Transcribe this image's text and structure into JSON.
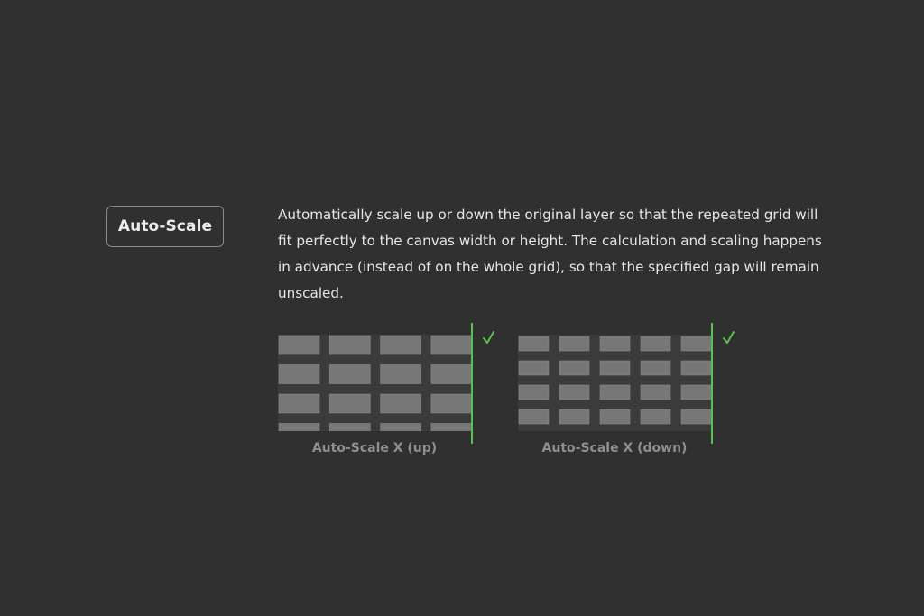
{
  "title_label": "Auto-Scale",
  "description": [
    "Automatically scale up or down the original layer so that the repeated grid will",
    "fit perfectly to the canvas width or height. The calculation and scaling happens",
    "in advance (instead of on the whole grid), so that the specified gap will remain",
    "unscaled."
  ],
  "examples": [
    {
      "caption": "Auto-Scale X (up)",
      "columns": 4,
      "rows_visible": 4,
      "icon": "check-icon"
    },
    {
      "caption": "Auto-Scale X (down)",
      "columns": 5,
      "rows_visible": 4,
      "icon": "check-icon"
    }
  ],
  "colors": {
    "background": "#303030",
    "cell": "#777777",
    "accent": "#55c44a"
  }
}
